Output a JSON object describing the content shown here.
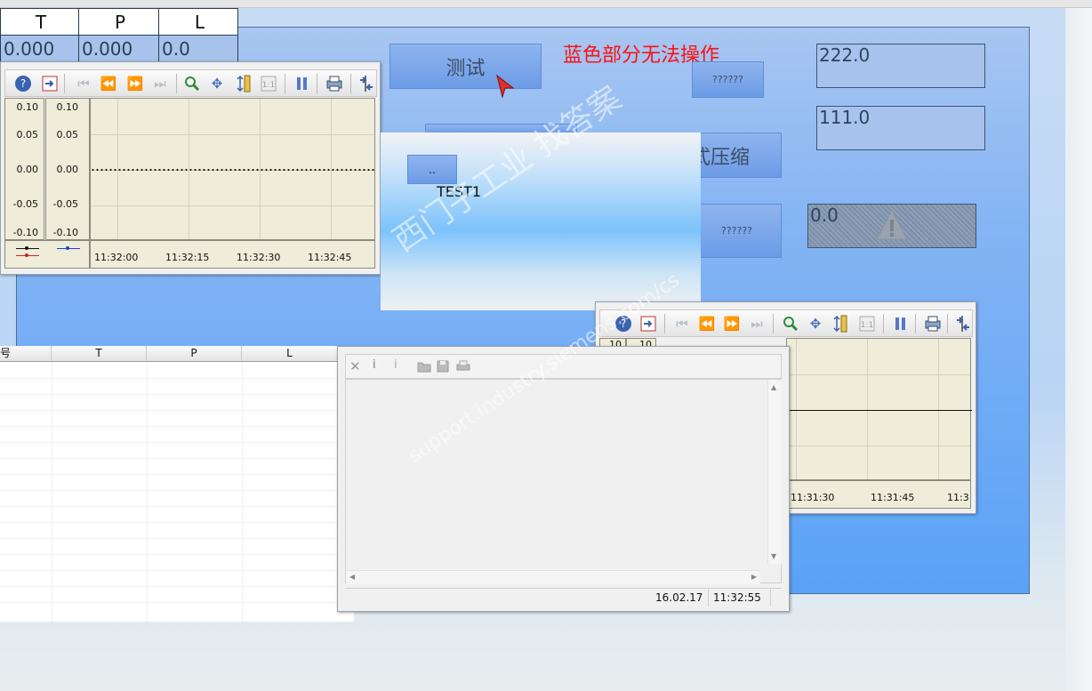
{
  "colors": {
    "panel": "#84b4f4",
    "warn_text": "#ff1010",
    "io_field": "#a7c2ec",
    "plot_bg": "#efecd9"
  },
  "notice": {
    "text": "蓝色部分无法操作"
  },
  "buttons": {
    "test_label": "测试",
    "q1_label": "??????",
    "compress_label": "式压缩",
    "q2_label": "??????"
  },
  "io_fields": {
    "field1": "222.0",
    "field2": "111.0",
    "field3": "0.0"
  },
  "top_table": {
    "headers": [
      "T",
      "P",
      "L"
    ],
    "values": [
      "0.000",
      "0.000",
      "0.0"
    ]
  },
  "trend1": {
    "left_axis": [
      "0.10",
      "0.05",
      "0.00",
      "-0.05",
      "-0.10"
    ],
    "right_axis": [
      "0.10",
      "0.05",
      "0.00",
      "-0.05",
      "-0.10"
    ],
    "x_ticks": [
      "11:32:00",
      "11:32:15",
      "11:32:30",
      "11:32:45"
    ]
  },
  "trend2": {
    "axis_partial": [
      "10",
      "10"
    ],
    "x_ticks": [
      "11:31:30",
      "11:31:45",
      "11:3"
    ]
  },
  "popup": {
    "button_label": "..",
    "label": "TEST1"
  },
  "bottom_table": {
    "headers": [
      "号",
      "T",
      "P",
      "L"
    ]
  },
  "alarm": {
    "date": "16.02.17",
    "time": "11:32:55"
  },
  "watermark": {
    "line1": "西门子工业  找答案",
    "line2": "support.industry.siemens.com/cs"
  },
  "icons": [
    "help-icon",
    "config-icon",
    "first-icon",
    "prev-icon",
    "next-icon",
    "last-icon",
    "zoom-icon",
    "move-icon",
    "ruler-icon",
    "scale-icon",
    "pause-icon",
    "print-icon",
    "export-icon",
    "warning-icon",
    "close-icon",
    "open-icon",
    "save-icon",
    "printer-icon"
  ]
}
